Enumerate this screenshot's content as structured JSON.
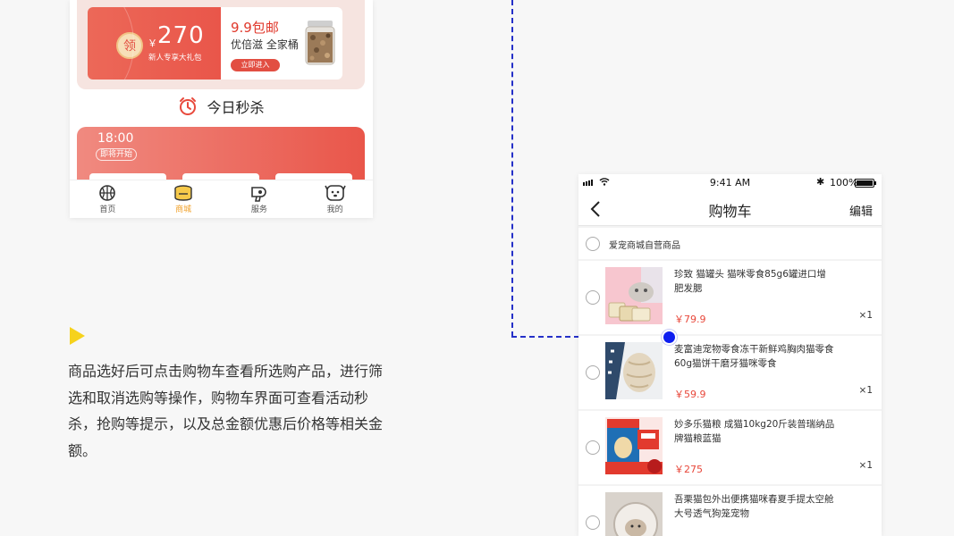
{
  "left_phone": {
    "coupon": {
      "badge": "领",
      "currency": "￥",
      "amount": "270",
      "desc": "新人专享大礼包"
    },
    "deal": {
      "title": "9.9包邮",
      "subtitle": "优倍滋 全家桶",
      "button": "立即进入"
    },
    "flash_sale": {
      "title": "今日秒杀",
      "time": "18:00",
      "status": "即将开始"
    },
    "tabs": [
      {
        "label": "首页",
        "icon": "basketball-icon",
        "active": false
      },
      {
        "label": "商城",
        "icon": "pet-food-can-icon",
        "active": true
      },
      {
        "label": "服务",
        "icon": "hair-dryer-icon",
        "active": false
      },
      {
        "label": "我的",
        "icon": "dog-face-icon",
        "active": false
      }
    ]
  },
  "description": "商品选好后可点击购物车查看所选购产品，进行筛选和取消选购等操作，购物车界面可查看活动秒杀，抢购等提示，以及总金额优惠后价格等相关金额。",
  "right_phone": {
    "status_bar": {
      "time": "9:41 AM",
      "battery": "100%"
    },
    "nav": {
      "title": "购物车",
      "edit": "编辑"
    },
    "store": {
      "name": "爱宠商城自营商品"
    },
    "items": [
      {
        "title": "珍致 猫罐头 猫咪零食85g6罐进口增肥发腮",
        "price": "￥79.9",
        "qty": "×1"
      },
      {
        "title": "麦富迪宠物零食冻干新鲜鸡胸肉猫零食60g猫饼干磨牙猫咪零食",
        "price": "￥59.9",
        "qty": "×1"
      },
      {
        "title": "妙多乐猫粮 成猫10kg20斤装普瑞纳品牌猫粮蓝猫",
        "price": "￥275",
        "qty": "×1"
      },
      {
        "title": "吾栗猫包外出便携猫咪春夏手提太空舱大号透气狗笼宠物",
        "price": "",
        "qty": ""
      }
    ]
  },
  "colors": {
    "accent_red": "#e9564a",
    "active_tab": "#f0a12a",
    "connector_blue": "#2530c8",
    "marker_yellow": "#f6d21c"
  }
}
